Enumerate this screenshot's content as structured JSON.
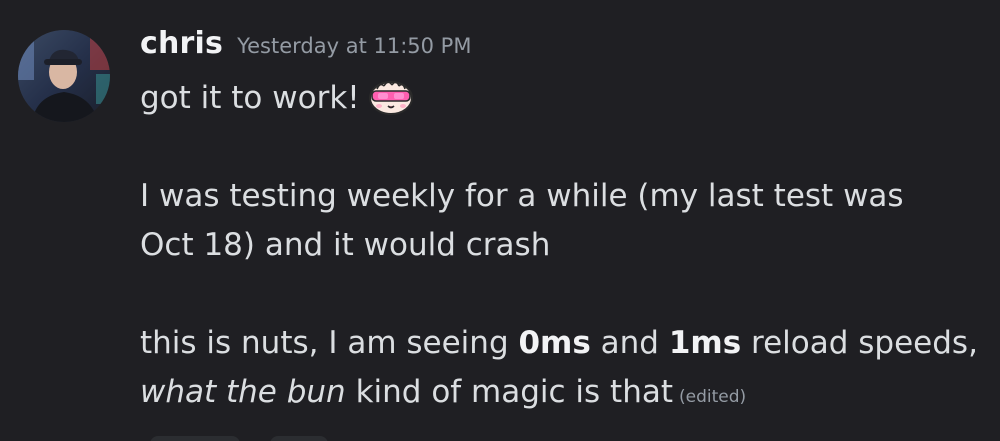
{
  "message": {
    "author": "chris",
    "timestamp": "Yesterday at 11:50 PM",
    "lines": {
      "first": "got it to work!",
      "second": "I was testing weekly for a while (my last test was",
      "third": "Oct 18) and it would crash",
      "fourth_a": "this is nuts, I am seeing ",
      "fourth_bold1": "0ms",
      "fourth_b": " and ",
      "fourth_bold2": "1ms",
      "fourth_c": " reload speeds,",
      "fifth_italic": "what the bun",
      "fifth_rest": " kind of magic is that",
      "edited": "(edited)"
    },
    "emoji": "bun-with-sunglasses-emoji",
    "avatar": "user-avatar-photo"
  },
  "colors": {
    "background": "#1f1f23",
    "text": "#dbdee1",
    "username": "#f2f3f5",
    "muted": "#949ba4",
    "emoji_pink": "#ff5fb0"
  }
}
